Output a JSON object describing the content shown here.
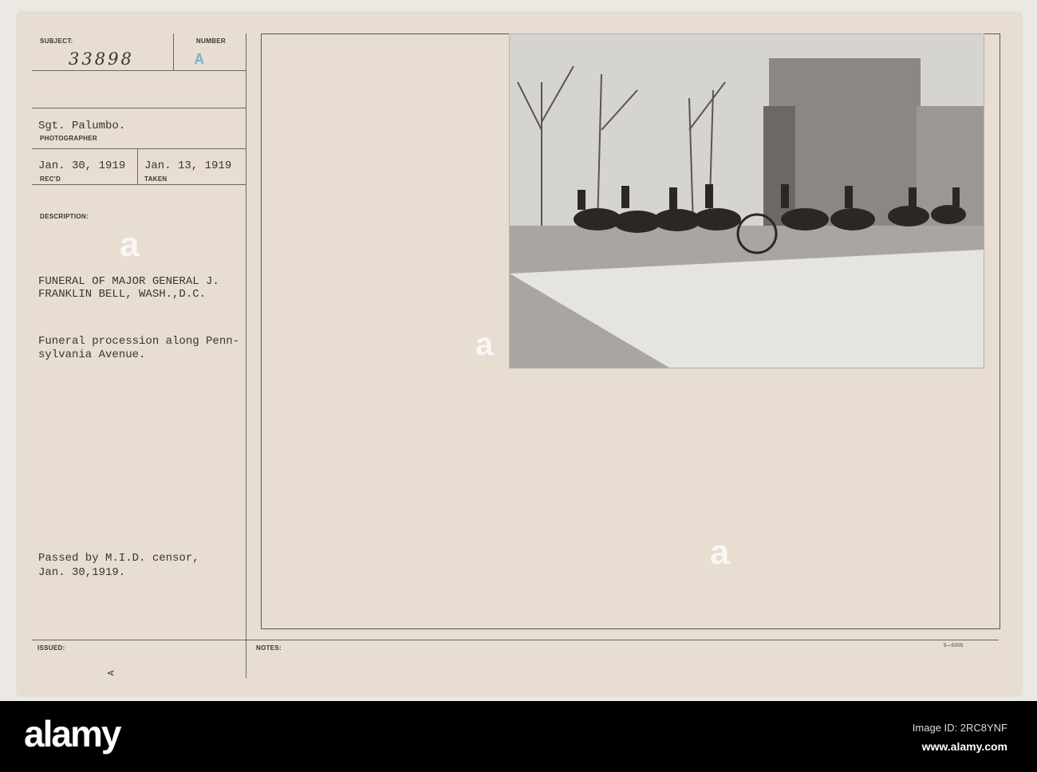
{
  "card": {
    "subject_label": "SUBJECT:",
    "subject_number": "33898",
    "number_label": "NUMBER",
    "number_value": "A",
    "photographer": "Sgt. Palumbo.",
    "photographer_label": "PHOTOGRAPHER",
    "received_date": "Jan. 30, 1919",
    "received_label": "REC'D",
    "taken_date": "Jan. 13, 1919",
    "taken_label": "TAKEN",
    "description_label": "DESCRIPTION:",
    "title_line1": "FUNERAL OF MAJOR GENERAL J.",
    "title_line2": "FRANKLIN BELL, WASH.,D.C.",
    "caption_line1": "Funeral procession along Penn-",
    "caption_line2": "sylvania Avenue.",
    "censor_line1": "Passed by M.I.D. censor,",
    "censor_line2": "Jan. 30,1919.",
    "issued_label": "ISSUED:",
    "issued_mark": "A",
    "notes_label": "NOTES:",
    "form_code": "5—5005"
  },
  "watermark": {
    "brand": "alamy",
    "image_id": "Image ID: 2RC8YNF",
    "url": "www.alamy.com"
  },
  "colors": {
    "card": "#e7ddd1",
    "stamp_blue": "#7fb2c9",
    "footer": "#000000"
  }
}
